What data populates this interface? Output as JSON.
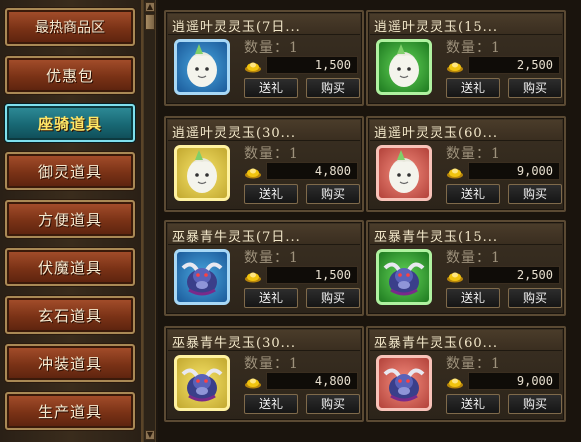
{
  "sidebar": {
    "categories": [
      {
        "label": "最热商品区",
        "active": false
      },
      {
        "label": "优惠包",
        "active": false
      },
      {
        "label": "座骑道具",
        "active": true
      },
      {
        "label": "御灵道具",
        "active": false
      },
      {
        "label": "方便道具",
        "active": false
      },
      {
        "label": "伏魔道具",
        "active": false
      },
      {
        "label": "玄石道具",
        "active": false
      },
      {
        "label": "冲装道具",
        "active": false
      },
      {
        "label": "生产道具",
        "active": false
      }
    ]
  },
  "scrollbar": {
    "up": "▲",
    "down": "▼"
  },
  "shop": {
    "qty_label": "数量：",
    "gift_label": "送礼",
    "buy_label": "购买",
    "items": [
      {
        "title": "逍遥叶灵灵玉(7日...",
        "qty": "1",
        "price": "1,500",
        "icon": "spirit-jade-blue-icon",
        "frame": "blue"
      },
      {
        "title": "逍遥叶灵灵玉(15...",
        "qty": "1",
        "price": "2,500",
        "icon": "spirit-jade-green-icon",
        "frame": "green"
      },
      {
        "title": "逍遥叶灵灵玉(30...",
        "qty": "1",
        "price": "4,800",
        "icon": "spirit-jade-yellow-icon",
        "frame": "yellow"
      },
      {
        "title": "逍遥叶灵灵玉(60...",
        "qty": "1",
        "price": "9,000",
        "icon": "spirit-jade-pink-icon",
        "frame": "pink"
      },
      {
        "title": "巫暴青牛灵玉(7日...",
        "qty": "1",
        "price": "1,500",
        "icon": "ox-jade-blue-icon",
        "frame": "blue"
      },
      {
        "title": "巫暴青牛灵玉(15...",
        "qty": "1",
        "price": "2,500",
        "icon": "ox-jade-green-icon",
        "frame": "green"
      },
      {
        "title": "巫暴青牛灵玉(30...",
        "qty": "1",
        "price": "4,800",
        "icon": "ox-jade-yellow-icon",
        "frame": "yellow"
      },
      {
        "title": "巫暴青牛灵玉(60...",
        "qty": "1",
        "price": "9,000",
        "icon": "ox-jade-pink-icon",
        "frame": "pink"
      }
    ]
  },
  "colors": {
    "active_text": "#ffe766",
    "active_bg": "#186874",
    "button_bg": "#7a3216"
  }
}
